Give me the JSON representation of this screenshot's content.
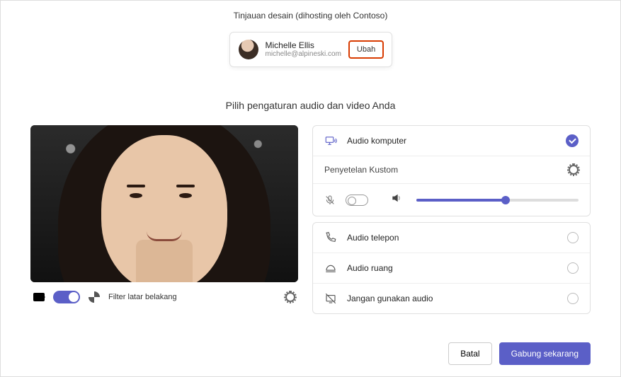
{
  "meeting": {
    "title": "Tinjauan desain (dihosting oleh Contoso)"
  },
  "user": {
    "name": "Michelle Ellis",
    "email": "michelle@alpineski.com",
    "change_label": "Ubah"
  },
  "subtitle": "Pilih pengaturan audio dan video Anda",
  "video": {
    "camera_on": true,
    "bg_filter_label": "Filter latar belakang"
  },
  "audio": {
    "computer": {
      "label": "Audio komputer",
      "selected": true
    },
    "custom_label": "Penyetelan Kustom",
    "mic_muted": true,
    "volume_percent": 55,
    "phone": {
      "label": "Audio telepon",
      "selected": false
    },
    "room": {
      "label": "Audio ruang",
      "selected": false
    },
    "none": {
      "label": "Jangan gunakan audio",
      "selected": false
    }
  },
  "footer": {
    "cancel": "Batal",
    "join": "Gabung sekarang"
  }
}
